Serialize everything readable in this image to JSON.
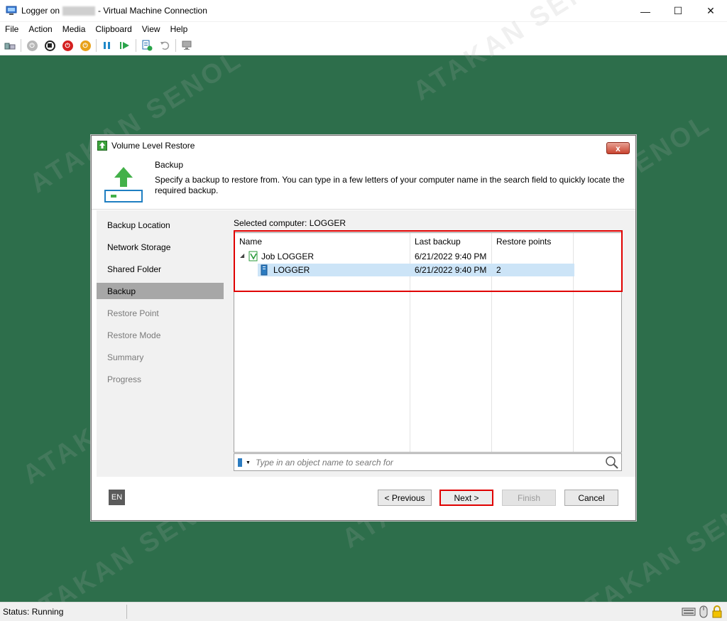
{
  "window": {
    "title_prefix": "Logger on",
    "title_suffix": "- Virtual Machine Connection",
    "minimize": "—",
    "maximize": "☐",
    "close": "✕"
  },
  "menu": [
    "File",
    "Action",
    "Media",
    "Clipboard",
    "View",
    "Help"
  ],
  "toolbar_icons": [
    "ctrl-alt-del-icon",
    "start-icon",
    "turn-off-icon",
    "shutdown-icon",
    "save-icon",
    "pause-icon",
    "reset-icon",
    "checkpoint-icon",
    "revert-icon",
    "enhanced-session-icon"
  ],
  "status": {
    "text": "Status: Running"
  },
  "dialog": {
    "title": "Volume Level Restore",
    "close": "x",
    "header": {
      "title": "Backup",
      "description": "Specify a backup to restore from. You can type in a few letters of your computer name in the search field to quickly locate the required backup."
    },
    "nav": [
      {
        "label": "Backup Location",
        "state": "done"
      },
      {
        "label": "Network Storage",
        "state": "done"
      },
      {
        "label": "Shared Folder",
        "state": "done"
      },
      {
        "label": "Backup",
        "state": "active"
      },
      {
        "label": "Restore Point",
        "state": "disabled"
      },
      {
        "label": "Restore Mode",
        "state": "disabled"
      },
      {
        "label": "Summary",
        "state": "disabled"
      },
      {
        "label": "Progress",
        "state": "disabled"
      }
    ],
    "selected_computer": "Selected computer: LOGGER",
    "grid": {
      "columns": [
        "Name",
        "Last backup",
        "Restore points"
      ],
      "rows": [
        {
          "name": "Job LOGGER",
          "last_backup": "6/21/2022 9:40 PM",
          "restore_points": "",
          "level": 0,
          "expanded": true
        },
        {
          "name": "LOGGER",
          "last_backup": "6/21/2022 9:40 PM",
          "restore_points": "2",
          "level": 1,
          "selected": true
        }
      ]
    },
    "search": {
      "placeholder": "Type in an object name to search for"
    },
    "language": "EN",
    "buttons": {
      "previous": "< Previous",
      "next": "Next >",
      "finish": "Finish",
      "cancel": "Cancel"
    }
  },
  "watermark": "ATAKAN SENOL",
  "colors": {
    "vm_background": "#2d6e4b",
    "highlight": "#e00000",
    "selection": "#cce4f7",
    "nav_active": "#a7a7a7"
  }
}
